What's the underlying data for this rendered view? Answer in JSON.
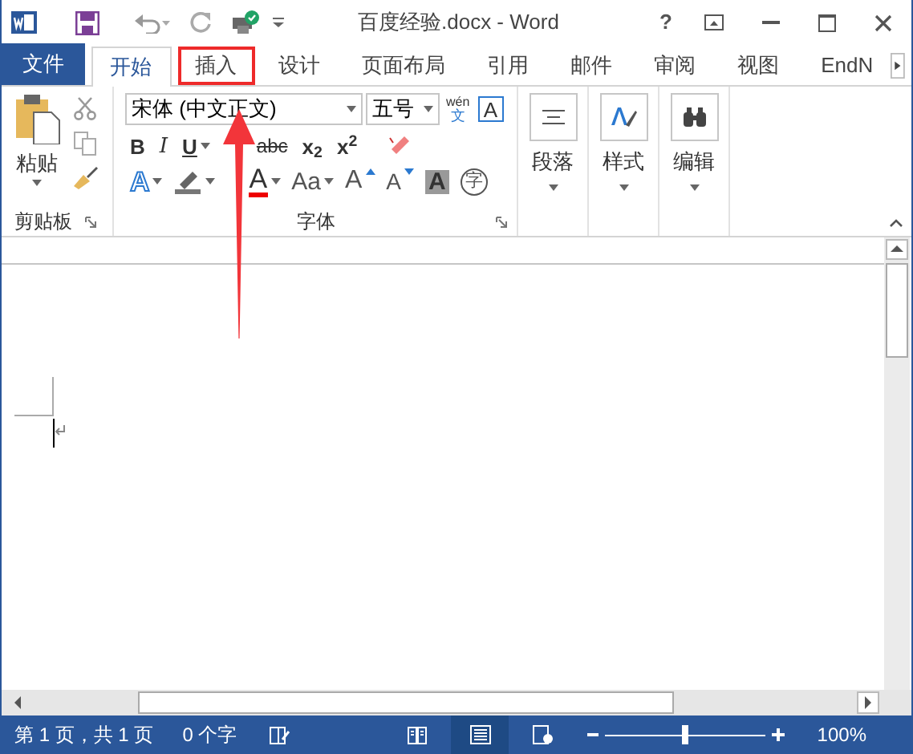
{
  "window": {
    "title": "百度经验.docx - Word",
    "help": "?"
  },
  "tabs": [
    {
      "label": "文件",
      "kind": "file",
      "selected": false,
      "highlighted": false
    },
    {
      "label": "开始",
      "kind": "tab",
      "selected": true,
      "highlighted": false
    },
    {
      "label": "插入",
      "kind": "tab",
      "selected": false,
      "highlighted": true
    },
    {
      "label": "设计",
      "kind": "tab",
      "selected": false,
      "highlighted": false
    },
    {
      "label": "页面布局",
      "kind": "tab",
      "selected": false,
      "highlighted": false
    },
    {
      "label": "引用",
      "kind": "tab",
      "selected": false,
      "highlighted": false
    },
    {
      "label": "邮件",
      "kind": "tab",
      "selected": false,
      "highlighted": false
    },
    {
      "label": "审阅",
      "kind": "tab",
      "selected": false,
      "highlighted": false
    },
    {
      "label": "视图",
      "kind": "tab",
      "selected": false,
      "highlighted": false
    },
    {
      "label": "EndN",
      "kind": "tab",
      "selected": false,
      "highlighted": false
    }
  ],
  "ribbon": {
    "clipboard": {
      "paste": "粘贴",
      "label": "剪贴板"
    },
    "font": {
      "name": "宋体 (中文正文)",
      "size": "五号",
      "phonetic_top": "wén",
      "phonetic_bottom": "文",
      "border_char": "A",
      "label": "字体",
      "row1": [
        {
          "label": "B",
          "kind": "bold"
        },
        {
          "label": "I",
          "kind": "italic"
        },
        {
          "label": "U",
          "kind": "underline"
        },
        {
          "label": "abc",
          "kind": "strike"
        },
        {
          "label": "x$_{2}$",
          "kind": "sub"
        },
        {
          "label": "x$^{2}$",
          "kind": "super"
        }
      ],
      "row2": [
        {
          "label": "A",
          "kind": "effects"
        },
        {
          "kind": "highlight"
        },
        {
          "label": "A",
          "kind": "font_color"
        },
        {
          "label": "Aa",
          "kind": "case"
        },
        {
          "label": "A",
          "kind": "grow"
        },
        {
          "label": "A",
          "kind": "shrink"
        },
        {
          "label": "A",
          "kind": "shade"
        },
        {
          "label": "字",
          "kind": "enclose"
        }
      ]
    },
    "large_groups": [
      {
        "label": "段落",
        "kind": "paragraph"
      },
      {
        "label": "样式",
        "kind": "styles"
      },
      {
        "label": "编辑",
        "kind": "editing"
      }
    ]
  },
  "annotation": {
    "arrow": true
  },
  "status_bar": {
    "page": "第 1 页，共 1 页",
    "words": "0 个字",
    "views": [
      {
        "kind": "read",
        "selected": false
      },
      {
        "kind": "print",
        "selected": true
      },
      {
        "kind": "web",
        "selected": false
      }
    ],
    "zoom": {
      "level": 0.5
    },
    "zoom_text": "100%"
  }
}
